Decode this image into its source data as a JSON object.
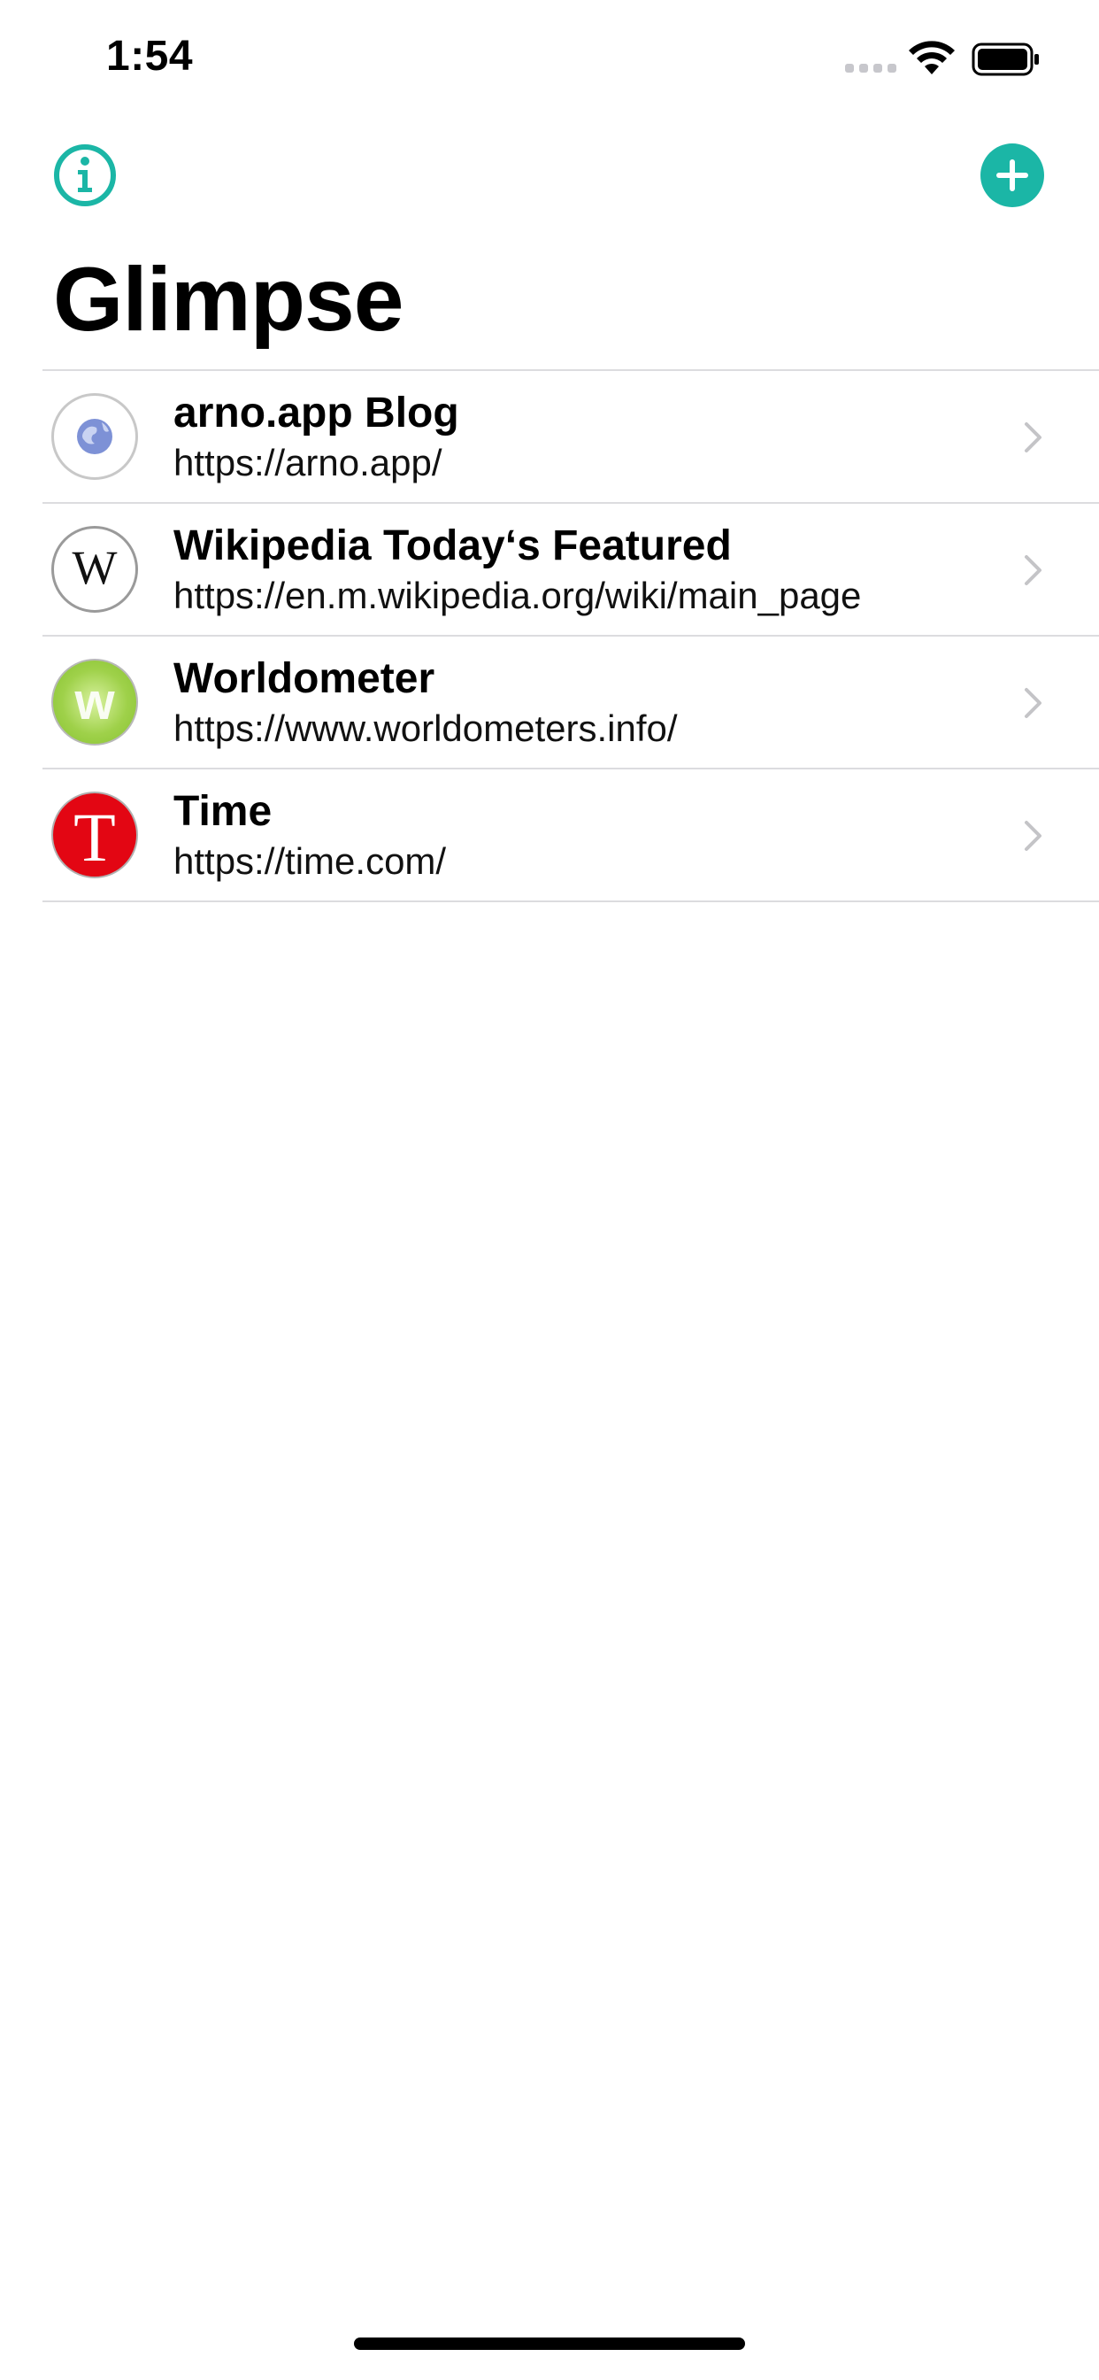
{
  "status_bar": {
    "time": "1:54"
  },
  "nav": {
    "title": "Glimpse",
    "accent": "#1bb6a6"
  },
  "items": [
    {
      "title": "arno.app Blog",
      "url": "https://arno.app/",
      "icon": "globe-icon"
    },
    {
      "title": "Wikipedia Today‘s Featured",
      "url": "https://en.m.wikipedia.org/wiki/main_page",
      "icon": "wikipedia-w-icon"
    },
    {
      "title": "Worldometer",
      "url": "https://www.worldometers.info/",
      "icon": "worldometer-w-icon"
    },
    {
      "title": "Time",
      "url": "https://time.com/",
      "icon": "time-t-icon"
    }
  ]
}
